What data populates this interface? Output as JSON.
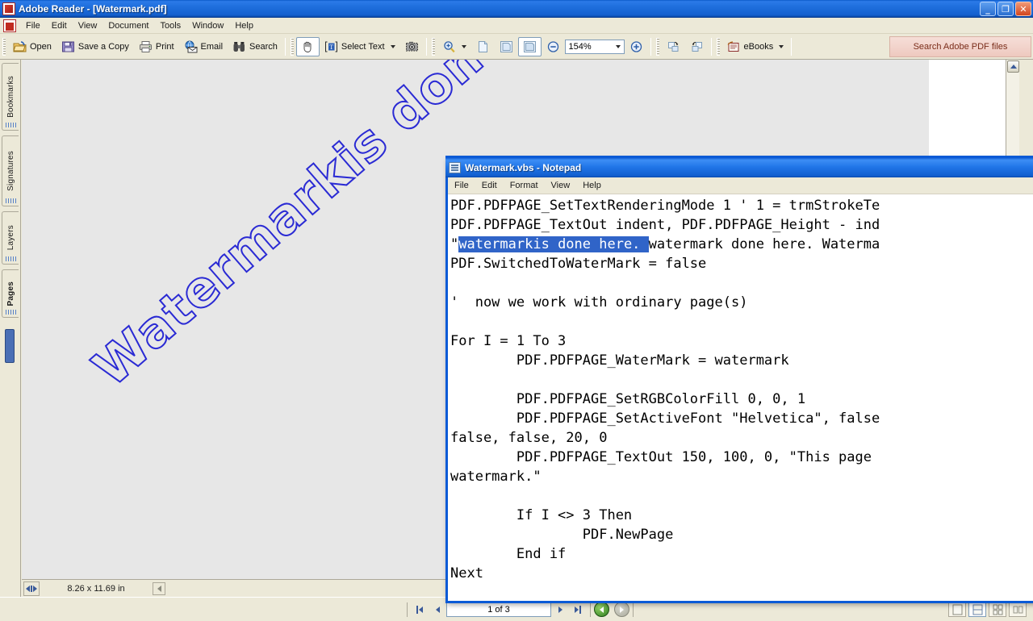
{
  "reader": {
    "title": "Adobe Reader  - [Watermark.pdf]",
    "window_controls": {
      "minimize": "_",
      "restore": "❐",
      "close": "✕"
    },
    "menu": [
      "File",
      "Edit",
      "View",
      "Document",
      "Tools",
      "Window",
      "Help"
    ],
    "toolbar": {
      "open": "Open",
      "save_a_copy": "Save a Copy",
      "print": "Print",
      "email": "Email",
      "search": "Search",
      "select_text": "Select Text",
      "zoom_value": "154%",
      "ebooks": "eBooks",
      "search_adobe": "Search Adobe PDF files"
    },
    "sidebar_tabs": [
      {
        "label": "Bookmarks",
        "active": false
      },
      {
        "label": "Signatures",
        "active": false
      },
      {
        "label": "Layers",
        "active": false
      },
      {
        "label": "Pages",
        "active": true
      }
    ],
    "page": {
      "watermark_text": "Watermarkis done here.",
      "watermark_color": "#2a2ad4",
      "size_label": "8.26 x 11.69 in"
    },
    "status": {
      "page_indicator": "1 of 3"
    }
  },
  "notepad": {
    "title": "Watermark.vbs - Notepad",
    "menu": [
      "File",
      "Edit",
      "Format",
      "View",
      "Help"
    ],
    "selection_color": "#3064c8",
    "lines": [
      {
        "text": "PDF.PDFPAGE_SetTextRenderingMode 1 ' 1 = trmStrokeTe"
      },
      {
        "text": "PDF.PDFPAGE_TextOut indent, PDF.PDFPAGE_Height - ind"
      },
      {
        "pre": "\"",
        "selected": "watermarkis done here. ",
        "post": "watermark done here. Waterma"
      },
      {
        "text": "PDF.SwitchedToWaterMark = false"
      },
      {
        "text": ""
      },
      {
        "text": "'  now we work with ordinary page(s)"
      },
      {
        "text": ""
      },
      {
        "text": "For I = 1 To 3"
      },
      {
        "text": "        PDF.PDFPAGE_WaterMark = watermark"
      },
      {
        "text": ""
      },
      {
        "text": "        PDF.PDFPAGE_SetRGBColorFill 0, 0, 1"
      },
      {
        "text": "        PDF.PDFPAGE_SetActiveFont \"Helvetica\", false"
      },
      {
        "text": "false, false, 20, 0"
      },
      {
        "text": "        PDF.PDFPAGE_TextOut 150, 100, 0, \"This page"
      },
      {
        "text": "watermark.\""
      },
      {
        "text": ""
      },
      {
        "text": "        If I <> 3 Then"
      },
      {
        "text": "                PDF.NewPage"
      },
      {
        "text": "        End if"
      },
      {
        "text": "Next"
      }
    ]
  }
}
